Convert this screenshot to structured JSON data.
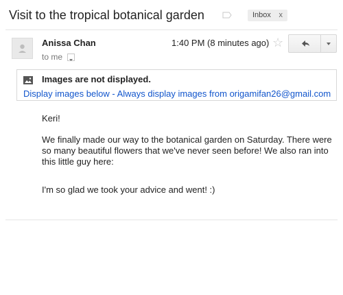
{
  "email": {
    "subject": "Visit to the tropical botanical garden",
    "label_chip": {
      "text": "Inbox",
      "remove": "x"
    },
    "sender_name": "Anissa Chan",
    "to_line": "to me",
    "timestamp": "1:40 PM (8 minutes ago)",
    "icons": {
      "label": "label-icon",
      "avatar": "avatar-icon",
      "star": "star-icon",
      "reply": "reply-icon",
      "more": "chevron-down-icon",
      "image": "image-icon"
    }
  },
  "images_notice": {
    "title": "Images are not displayed.",
    "display_below": "Display images below",
    "separator": " - ",
    "always_display": "Always display images from origamifan26@gmail.com"
  },
  "body": {
    "greeting": "Keri!",
    "paragraph1": "We finally made our way to the botanical garden on Saturday. There were so many beautiful flowers that we've never seen before! We also ran into this little guy here:",
    "paragraph2": "I'm so glad we took your advice and went! :)"
  }
}
